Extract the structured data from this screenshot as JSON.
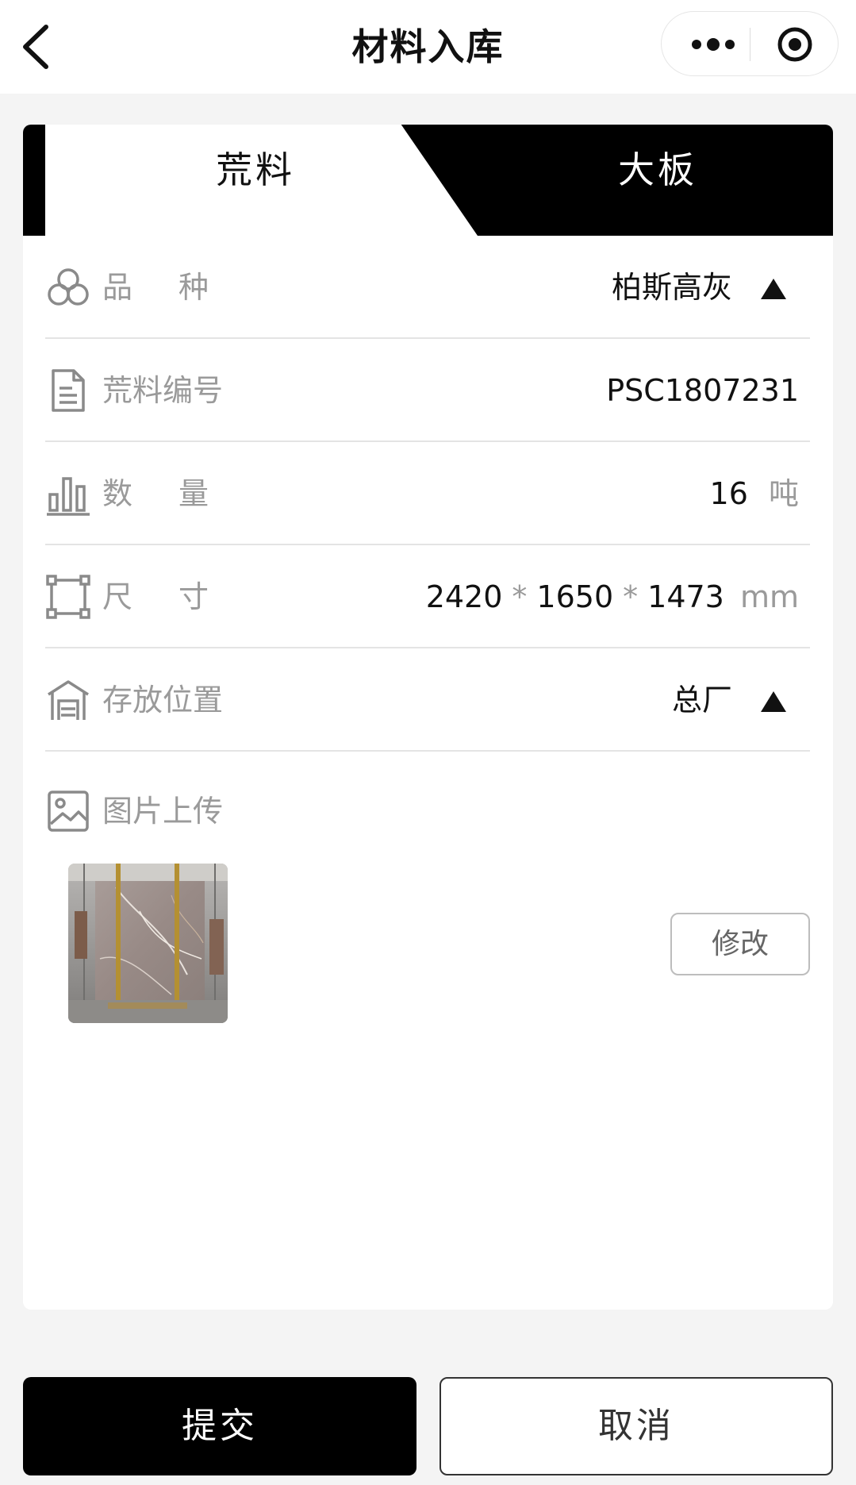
{
  "navbar": {
    "title": "材料入库"
  },
  "tabs": [
    {
      "label": "荒料",
      "active": true
    },
    {
      "label": "大板",
      "active": false
    }
  ],
  "form": {
    "variety": {
      "label": "品种",
      "value": "柏斯高灰"
    },
    "block_no": {
      "label": "荒料编号",
      "value": "PSC1807231"
    },
    "quantity": {
      "label": "数量",
      "value": "16",
      "unit": "吨"
    },
    "size": {
      "label": "尺寸",
      "length": "2420",
      "width": "1650",
      "height": "1473",
      "separator": "*",
      "unit": "mm"
    },
    "location": {
      "label": "存放位置",
      "value": "总厂"
    },
    "photo": {
      "label": "图片上传",
      "edit_label": "修改"
    }
  },
  "actions": {
    "submit_label": "提交",
    "cancel_label": "取消"
  },
  "colors": {
    "primary": "#000000",
    "label_gray": "#9a9a9a",
    "divider": "#e4e4e4",
    "background": "#f4f4f4"
  },
  "icons": [
    "back-icon",
    "more-icon",
    "target-icon",
    "variety-icon",
    "document-icon",
    "bar-chart-icon",
    "dimension-icon",
    "warehouse-icon",
    "image-icon",
    "dropdown-arrow-icon"
  ]
}
